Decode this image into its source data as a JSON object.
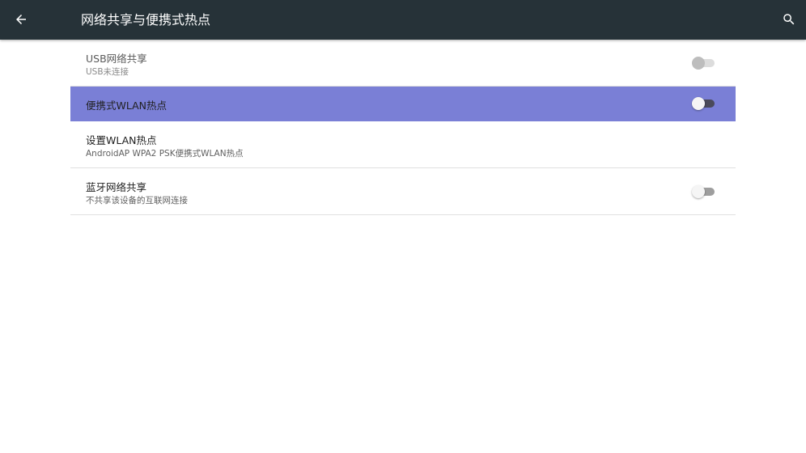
{
  "toolbar": {
    "title": "网络共享与便携式热点",
    "back_icon": "arrow-back-icon",
    "search_icon": "search-icon"
  },
  "colors": {
    "toolbar_bg": "#263238",
    "selected_row_bg": "#7a7fd6",
    "divider": "#e0e0e0"
  },
  "settings": {
    "items": [
      {
        "title": "USB网络共享",
        "summary": "USB未连接",
        "has_switch": true,
        "switch_on": false,
        "enabled": false
      },
      {
        "title": "便携式WLAN热点",
        "summary": "",
        "has_switch": true,
        "switch_on": false,
        "enabled": true,
        "selected": true
      },
      {
        "title": "设置WLAN热点",
        "summary": "AndroidAP WPA2 PSK便携式WLAN热点",
        "has_switch": false,
        "enabled": true
      },
      {
        "title": "蓝牙网络共享",
        "summary": "不共享该设备的互联网连接",
        "has_switch": true,
        "switch_on": false,
        "enabled": true
      }
    ]
  }
}
